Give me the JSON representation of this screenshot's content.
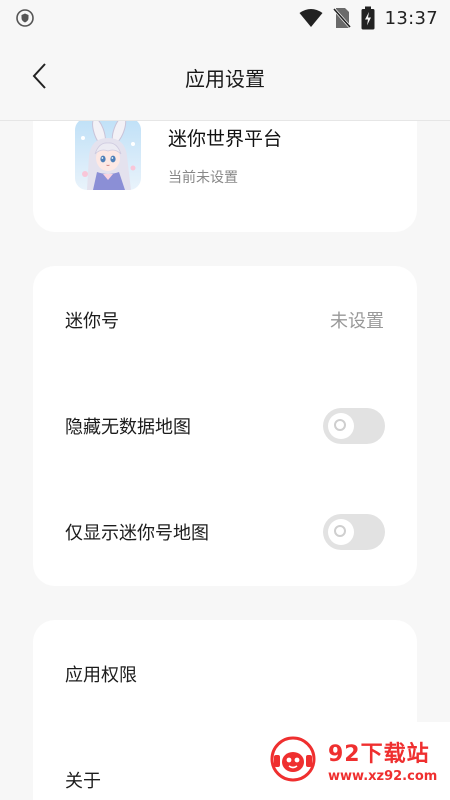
{
  "status_bar": {
    "time": "13:37",
    "icons": [
      "shield-icon",
      "wifi-icon",
      "no-sim-icon",
      "battery-charging-icon"
    ]
  },
  "header": {
    "title": "应用设置",
    "back_icon": "chevron-left-icon"
  },
  "app_card": {
    "app_name": "迷你世界平台",
    "status": "当前未设置"
  },
  "settings": {
    "mini_id_label": "迷你号",
    "mini_id_value": "未设置",
    "hide_no_data_label": "隐藏无数据地图",
    "hide_no_data_on": false,
    "only_mini_maps_label": "仅显示迷你号地图",
    "only_mini_maps_on": false
  },
  "bottom": {
    "permissions_label": "应用权限",
    "about_label": "关于"
  },
  "watermark": {
    "title": "92下载站",
    "url": "www.xz92.com"
  },
  "colors": {
    "background": "#f7f7f7",
    "card": "#ffffff",
    "toggle_off": "#e2e2e2",
    "watermark_red": "#ef2f2f"
  }
}
